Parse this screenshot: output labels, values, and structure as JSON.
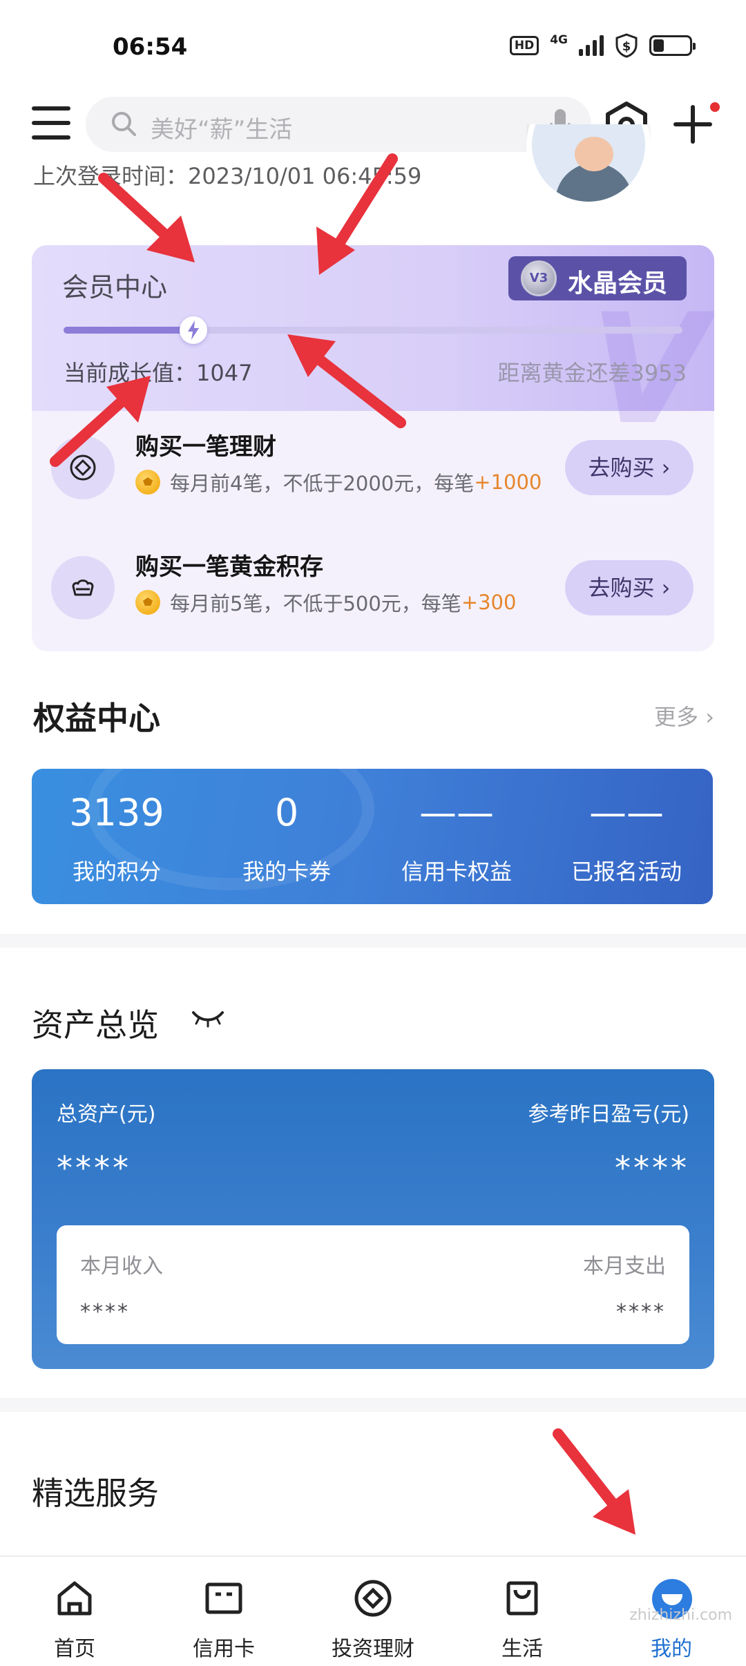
{
  "status_bar": {
    "time": "06:54",
    "hd": "HD",
    "network": "4G",
    "battery_level": 0.3
  },
  "top_bar": {
    "search_placeholder": "美好“薪”生活"
  },
  "account": {
    "last_login": "上次登录时间：2023/10/01 06:45:59"
  },
  "member_center": {
    "title": "会员中心",
    "badge_label": "水晶会员",
    "badge_medal": "V3",
    "growth_label": "当前成长值：1047",
    "gold_gap": "距离黄金还差3953",
    "progress": 0.21,
    "tasks": [
      {
        "title": "购买一笔理财",
        "desc": "每月前4笔，不低于2000元，每笔",
        "reward": "+1000",
        "button": "去购买 ›",
        "icon": "target-icon"
      },
      {
        "title": "购买一笔黄金积存",
        "desc": "每月前5笔，不低于500元，每笔",
        "reward": "+300",
        "button": "去购买 ›",
        "icon": "gold-ingot-icon"
      }
    ]
  },
  "benefits": {
    "title": "权益中心",
    "more": "更多 ›",
    "items": [
      {
        "value": "3139",
        "label": "我的积分"
      },
      {
        "value": "0",
        "label": "我的卡券"
      },
      {
        "value": "——",
        "label": "信用卡权益"
      },
      {
        "value": "——",
        "label": "已报名活动"
      }
    ]
  },
  "assets": {
    "title": "资产总览",
    "total_label": "总资产(元)",
    "yesterday_label": "参考昨日盈亏(元)",
    "total_value": "****",
    "yesterday_value": "****",
    "income_label": "本月收入",
    "expense_label": "本月支出",
    "income_value": "****",
    "expense_value": "****"
  },
  "services": {
    "title": "精选服务"
  },
  "bottom_nav": [
    {
      "label": "首页",
      "icon": "home-icon"
    },
    {
      "label": "信用卡",
      "icon": "credit-card-icon"
    },
    {
      "label": "投资理财",
      "icon": "invest-icon"
    },
    {
      "label": "生活",
      "icon": "shopping-bag-icon"
    },
    {
      "label": "我的",
      "icon": "mine-icon",
      "active": true
    }
  ],
  "watermark": "zhizhizhi.com",
  "colors": {
    "accent_blue": "#2d7de0",
    "member_purple": "#5b52a8",
    "reward_orange": "#e6862c",
    "annotation_red": "#e8323c"
  }
}
